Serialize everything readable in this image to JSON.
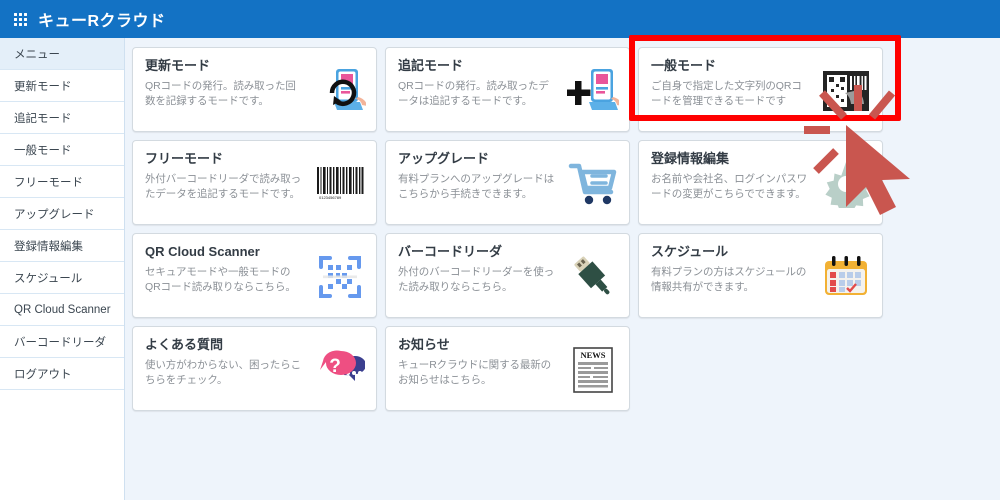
{
  "header": {
    "title": "キューRクラウド",
    "menu_icon": "grid-apps-icon",
    "background_color": "#1372c4"
  },
  "sidebar": {
    "items": [
      {
        "label": "メニュー",
        "active": true
      },
      {
        "label": "更新モード",
        "active": false
      },
      {
        "label": "追記モード",
        "active": false
      },
      {
        "label": "一般モード",
        "active": false
      },
      {
        "label": "フリーモード",
        "active": false
      },
      {
        "label": "アップグレード",
        "active": false
      },
      {
        "label": "登録情報編集",
        "active": false
      },
      {
        "label": "スケジュール",
        "active": false
      },
      {
        "label": "QR Cloud Scanner",
        "active": false
      },
      {
        "label": "バーコードリーダ",
        "active": false
      },
      {
        "label": "ログアウト",
        "active": false
      }
    ]
  },
  "main": {
    "background_color": "#eef4fb",
    "cards": [
      {
        "title": "更新モード",
        "desc": "QRコードの発行。読み取った回数を記録するモードです。",
        "icon": "phone-qr-refresh-icon"
      },
      {
        "title": "追記モード",
        "desc": "QRコードの発行。読み取ったデータは追記するモードです。",
        "icon": "phone-qr-plus-icon"
      },
      {
        "title": "一般モード",
        "desc": "ご自身で指定した文字列のQRコードを管理できるモードです",
        "icon": "qr-barcode-box-icon",
        "highlighted": true
      },
      {
        "title": "フリーモード",
        "desc": "外付バーコードリーダで読み取ったデータを追記するモードです。",
        "icon": "barcode-icon"
      },
      {
        "title": "アップグレード",
        "desc": "有料プランへのアップグレードはこちらから手続きできます。",
        "icon": "shopping-cart-icon"
      },
      {
        "title": "登録情報編集",
        "desc": "お名前や会社名、ログインパスワードの変更がこちらでできます。",
        "icon": "gear-icon"
      },
      {
        "title": "QR Cloud Scanner",
        "desc": "セキュアモードや一般モードのQRコード読み取りならこちら。",
        "icon": "qr-scan-icon"
      },
      {
        "title": "バーコードリーダ",
        "desc": "外付のバーコードリーダーを使った読み取りならこちら。",
        "icon": "usb-plug-icon"
      },
      {
        "title": "スケジュール",
        "desc": "有料プランの方はスケジュールの情報共有ができます。",
        "icon": "calendar-icon"
      },
      {
        "title": "よくある質問",
        "desc": "使い方がわからない、困ったらこちらをチェック。",
        "icon": "chat-question-icon"
      },
      {
        "title": "お知らせ",
        "desc": "キューRクラウドに関する最新のお知らせはこちら。",
        "icon": "news-paper-icon"
      }
    ]
  },
  "annotations": {
    "highlight": {
      "target_card": "一般モード",
      "color": "#ff0000",
      "name": "red-highlight-box"
    },
    "cursor": {
      "name": "click-cursor",
      "color": "#c9564f"
    }
  }
}
